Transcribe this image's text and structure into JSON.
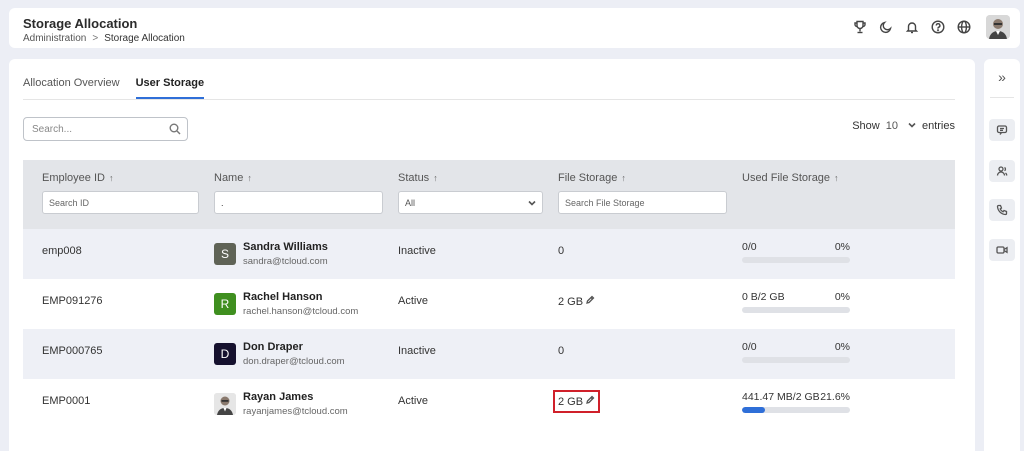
{
  "header": {
    "title": "Storage Allocation",
    "breadcrumb": {
      "parent": "Administration",
      "separator": ">",
      "current": "Storage Allocation"
    },
    "icons": [
      "trophy-icon",
      "moon-icon",
      "bell-icon",
      "help-icon",
      "globe-icon"
    ]
  },
  "tabs": [
    {
      "label": "Allocation Overview",
      "active": false
    },
    {
      "label": "User Storage",
      "active": true
    }
  ],
  "search": {
    "placeholder": "Search..."
  },
  "entries": {
    "show_label": "Show",
    "value": "10",
    "suffix": "entries"
  },
  "table": {
    "columns": [
      {
        "label": "Employee ID",
        "sort": "↑",
        "filter_placeholder": "Search ID"
      },
      {
        "label": "Name",
        "sort": "↑",
        "filter_value": "."
      },
      {
        "label": "Status",
        "sort": "↑",
        "filter_value": "All"
      },
      {
        "label": "File Storage",
        "sort": "↑",
        "filter_placeholder": "Search File Storage"
      },
      {
        "label": "Used File Storage",
        "sort": "↑"
      }
    ],
    "rows": [
      {
        "id": "emp008",
        "initial": "S",
        "avatar_color": "#5f6356",
        "name": "Sandra Williams",
        "email": "sandra@tcloud.com",
        "status": "Inactive",
        "storage": "0",
        "used": "0/0",
        "percent": "0%",
        "fill": 0
      },
      {
        "id": "EMP091276",
        "initial": "R",
        "avatar_color": "#3f8f1f",
        "name": "Rachel Hanson",
        "email": "rachel.hanson@tcloud.com",
        "status": "Active",
        "storage": "2 GB",
        "used": "0 B/2 GB",
        "percent": "0%",
        "fill": 0
      },
      {
        "id": "EMP000765",
        "initial": "D",
        "avatar_color": "#15112e",
        "name": "Don Draper",
        "email": "don.draper@tcloud.com",
        "status": "Inactive",
        "storage": "0",
        "used": "0/0",
        "percent": "0%",
        "fill": 0
      },
      {
        "id": "EMP0001",
        "initial": "",
        "avatar_color": "#e8e8e8",
        "name": "Rayan James",
        "email": "rayanjames@tcloud.com",
        "status": "Active",
        "storage": "2 GB",
        "used": "441.47 MB/2 GB",
        "percent": "21.6%",
        "fill": 21.6
      }
    ]
  },
  "sidebar": {
    "collapse_glyph": "»"
  }
}
